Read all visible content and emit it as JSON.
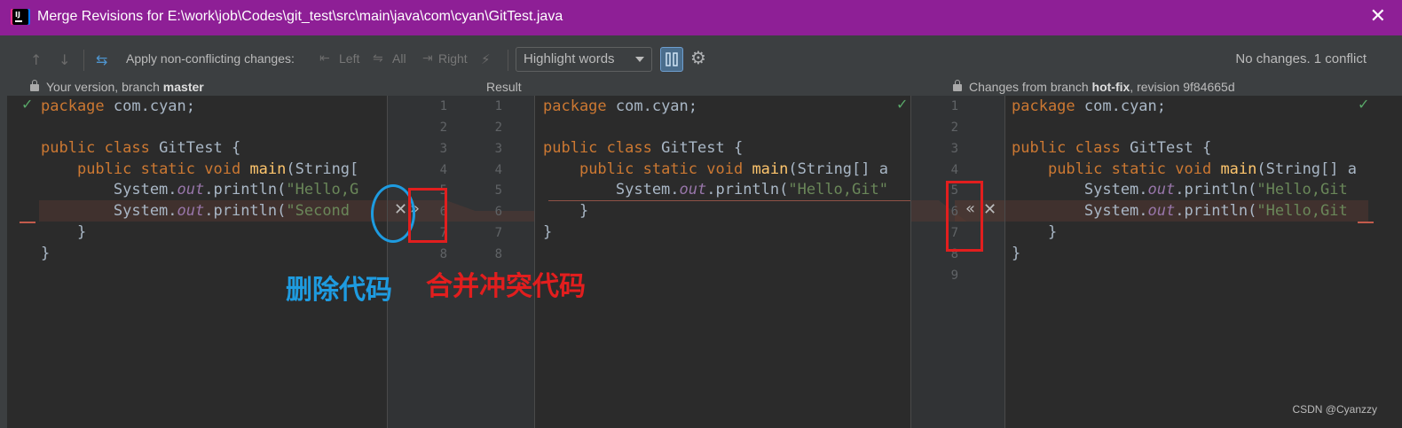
{
  "window": {
    "title": "Merge Revisions for E:\\work\\job\\Codes\\git_test\\src\\main\\java\\com\\cyan\\GitTest.java",
    "app_icon_text": "IJ"
  },
  "toolbar": {
    "apply_label": "Apply non-conflicting changes:",
    "left_label": "Left",
    "all_label": "All",
    "right_label": "Right",
    "highlight_select": "Highlight words",
    "status": "No changes. 1 conflict"
  },
  "headers": {
    "left_prefix": "Your version, branch ",
    "left_branch": "master",
    "center": "Result",
    "right_prefix": "Changes from branch ",
    "right_branch": "hot-fix",
    "right_suffix": ", revision 9f84665d"
  },
  "left_gutter_numbers": [
    "1",
    "2",
    "3",
    "4",
    "5",
    "6",
    "7",
    "8"
  ],
  "center_gutter_numbers": [
    "1",
    "2",
    "3",
    "4",
    "5",
    "6",
    "7",
    "8"
  ],
  "right_gutter_numbers": [
    "1",
    "2",
    "3",
    "4",
    "5",
    "6",
    "7",
    "8",
    "9"
  ],
  "annotations": {
    "delete_code": "删除代码",
    "merge_conflict": "合并冲突代码"
  },
  "watermark": "CSDN @Cyanzzy",
  "icons": {
    "toolbar": [
      "arrow-up-icon",
      "arrow-down-icon",
      "magic-resolve-icon",
      "apply-left-icon",
      "apply-all-icon",
      "apply-right-icon",
      "magic-wand-icon",
      "sync-scroll-toggle-icon",
      "gear-icon"
    ],
    "conflict": [
      "accept-left-icon",
      "ignore-left-icon",
      "accept-right-icon",
      "ignore-right-icon"
    ]
  },
  "colors": {
    "title_bar": "#8e1f96",
    "conflict_band": "#5a3a32",
    "annotation_blue": "#1e9be0",
    "annotation_red": "#e21e1e"
  }
}
